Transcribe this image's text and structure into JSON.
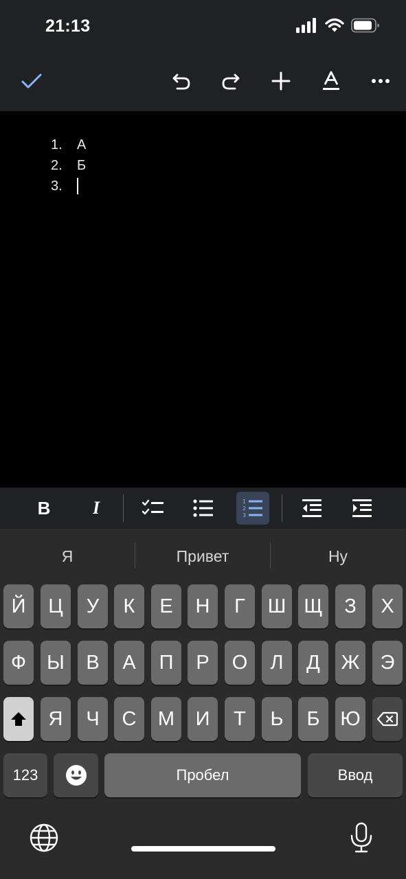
{
  "status": {
    "time": "21:13"
  },
  "toolbar": {
    "icons": [
      "check-icon",
      "undo-icon",
      "redo-icon",
      "plus-icon",
      "text-format-icon",
      "more-icon"
    ],
    "accent": "#8ab4f8"
  },
  "document": {
    "list": [
      {
        "number": "1.",
        "text": "А"
      },
      {
        "number": "2.",
        "text": "Б"
      },
      {
        "number": "3.",
        "text": ""
      }
    ]
  },
  "format_bar": {
    "bold_label": "B",
    "italic_label": "I",
    "icons": [
      "bold-icon",
      "italic-icon",
      "checklist-icon",
      "bullet-list-icon",
      "numbered-list-icon",
      "decrease-indent-icon",
      "increase-indent-icon"
    ],
    "active": "numbered-list-icon"
  },
  "keyboard": {
    "suggestions": [
      "Я",
      "Привет",
      "Ну"
    ],
    "row1": [
      "Й",
      "Ц",
      "У",
      "К",
      "Е",
      "Н",
      "Г",
      "Ш",
      "Щ",
      "З",
      "Х"
    ],
    "row2": [
      "Ф",
      "Ы",
      "В",
      "А",
      "П",
      "Р",
      "О",
      "Л",
      "Д",
      "Ж",
      "Э"
    ],
    "row3": [
      "Я",
      "Ч",
      "С",
      "М",
      "И",
      "Т",
      "Ь",
      "Б",
      "Ю"
    ],
    "numbers_label": "123",
    "space_label": "Пробел",
    "return_label": "Ввод"
  }
}
